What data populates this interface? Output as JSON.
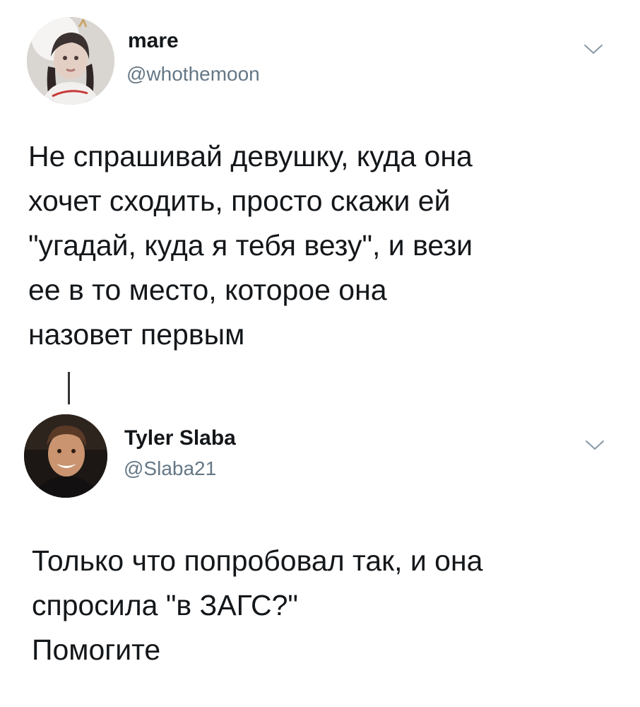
{
  "tweets": [
    {
      "display_name": "mare",
      "handle": "@whothemoon",
      "text_lines": [
        "Не спрашивай девушку, куда она",
        "хочет сходить, просто скажи ей",
        "\"угадай, куда я тебя везу\", и вези",
        "ее в то место, которое она",
        "назовет первым"
      ],
      "menu_icon": "chevron-down-icon"
    },
    {
      "display_name": "Tyler Slaba",
      "handle": "@Slaba21",
      "text_lines": [
        "Только что попробовал так, и она",
        "спросила \"в ЗАГС?\"",
        "Помогите"
      ],
      "menu_icon": "chevron-down-icon"
    }
  ],
  "colors": {
    "text": "#14171a",
    "secondary_text": "#657786",
    "chevron": "#8899a6",
    "thread_line": "#333333",
    "background": "#ffffff"
  }
}
